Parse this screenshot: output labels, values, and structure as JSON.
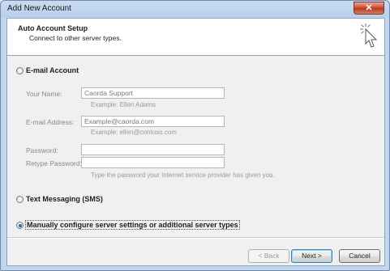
{
  "window": {
    "title": "Add New Account",
    "close_glyph": "✕"
  },
  "header": {
    "title": "Auto Account Setup",
    "subtitle": "Connect to other server types.",
    "icon": "wizard-cursor-icon"
  },
  "options": {
    "email_account": {
      "label": "E-mail Account",
      "selected": false
    },
    "text_messaging": {
      "label": "Text Messaging (SMS)",
      "selected": false
    },
    "manual": {
      "label": "Manually configure server settings or additional server types",
      "selected": true
    }
  },
  "form": {
    "your_name": {
      "label": "Your Name:",
      "value": "Caorda Support",
      "hint": "Example: Ellen Adams"
    },
    "email_address": {
      "label": "E-mail Address:",
      "value": "Example@caorda.com",
      "hint": "Example: ellen@contoso.com"
    },
    "password": {
      "label": "Password:",
      "value": ""
    },
    "retype_password": {
      "label": "Retype Password:",
      "value": "",
      "hint": "Type the password your Internet service provider has given you."
    }
  },
  "buttons": {
    "back": "< Back",
    "next": "Next >",
    "cancel": "Cancel"
  }
}
